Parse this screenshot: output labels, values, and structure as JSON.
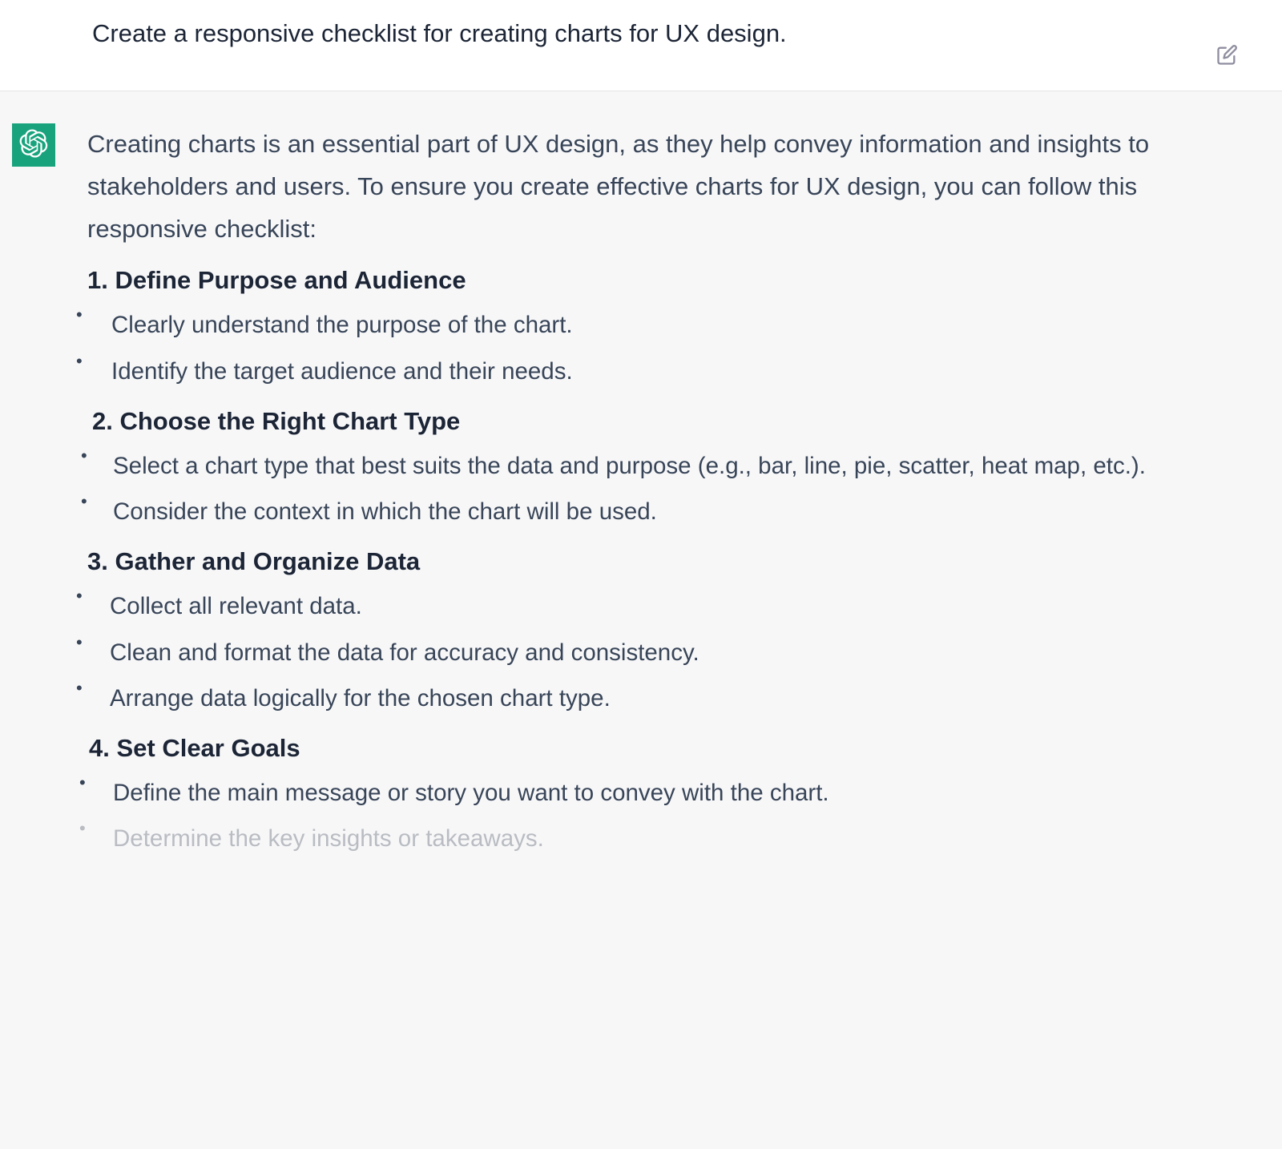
{
  "user": {
    "prompt": "Create a responsive checklist for creating charts for UX design."
  },
  "assistant": {
    "intro": "Creating charts is an essential part of UX design, as they help convey information and insights to stakeholders and users. To ensure you create effective charts for UX design, you can follow this responsive checklist:",
    "sections": [
      {
        "heading": "1. Define Purpose and Audience",
        "items": [
          "Clearly understand the purpose of the chart.",
          "Identify the target audience and their needs."
        ]
      },
      {
        "heading": "2. Choose the Right Chart Type",
        "items": [
          "Select a chart type that best suits the data and purpose (e.g., bar, line, pie, scatter, heat map, etc.).",
          "Consider the context in which the chart will be used."
        ]
      },
      {
        "heading": "3. Gather and Organize Data",
        "items": [
          "Collect all relevant data.",
          "Clean and format the data for accuracy and consistency.",
          "Arrange data logically for the chosen chart type."
        ]
      },
      {
        "heading": "4. Set Clear Goals",
        "items": [
          "Define the main message or story you want to convey with the chart.",
          "Determine the key insights or takeaways."
        ]
      }
    ]
  },
  "colors": {
    "avatar_bg": "#19a37d",
    "assistant_bg": "#f7f7f8",
    "text_primary": "#1c2536",
    "text_body": "#384558"
  }
}
